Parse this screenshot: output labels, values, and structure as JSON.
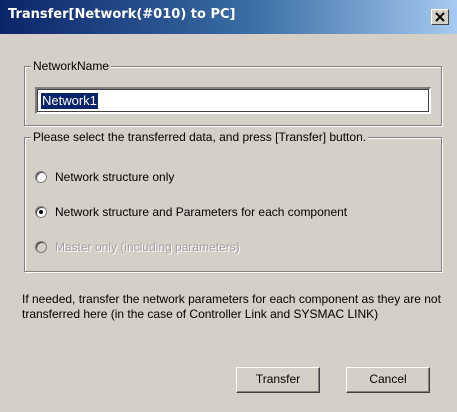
{
  "window": {
    "title": "Transfer[Network(#010) to PC]",
    "close_glyph": "×",
    "close_icon": "close-icon"
  },
  "network_name_group": {
    "legend": "NetworkName",
    "value": "Network1"
  },
  "select_group": {
    "legend": "Please select the transferred data, and press [Transfer] button.",
    "options": [
      {
        "label": "Network structure only",
        "selected": false,
        "enabled": true
      },
      {
        "label": "Network structure and Parameters for each component",
        "selected": true,
        "enabled": true
      },
      {
        "label": "Master only (including parameters)",
        "selected": false,
        "enabled": false
      }
    ]
  },
  "note": "If needed, transfer the network parameters for each component as they are not transferred here (in the case of Controller Link and SYSMAC LINK)",
  "buttons": {
    "transfer": "Transfer",
    "cancel": "Cancel"
  },
  "colors": {
    "titlebar_start": "#0a246a",
    "titlebar_end": "#a6caf0",
    "face": "#d4d0c8",
    "selection": "#0a246a"
  }
}
